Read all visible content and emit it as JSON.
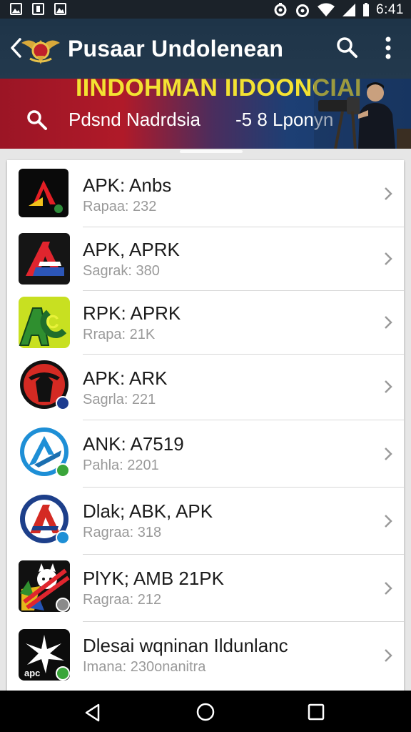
{
  "status_bar": {
    "time": "6:41"
  },
  "header": {
    "title": "Pusaar Undolenean"
  },
  "banner": {
    "headline": "IINDOHMAN IIDOONCIAI",
    "search_text": "Pdsnd Nadrdsia",
    "right_text": "-5 8 Lponyn"
  },
  "apps": [
    {
      "name": "APK: Anbs",
      "meta": "Rapaa: 232"
    },
    {
      "name": "APK, APRK",
      "meta": "Sagrak: 380"
    },
    {
      "name": "RPK: APRK",
      "meta": "Rrapa: 21K"
    },
    {
      "name": "APK: ARK",
      "meta": "Sagrla: 221"
    },
    {
      "name": "ANK: A7519",
      "meta": "Pahla: 2201"
    },
    {
      "name": "Dlak; ABK, APK",
      "meta": "Ragraa: 318"
    },
    {
      "name": "PlYK; AMB 21PK",
      "meta": "Ragraa: 212"
    },
    {
      "name": "Dlesai wqninan Ildunlanc",
      "meta": "Imana: 230onanitra"
    }
  ],
  "colors": {
    "app_bar": "#1e3448",
    "banner_headline": "#f3e232",
    "status_bar": "#1b2229"
  }
}
